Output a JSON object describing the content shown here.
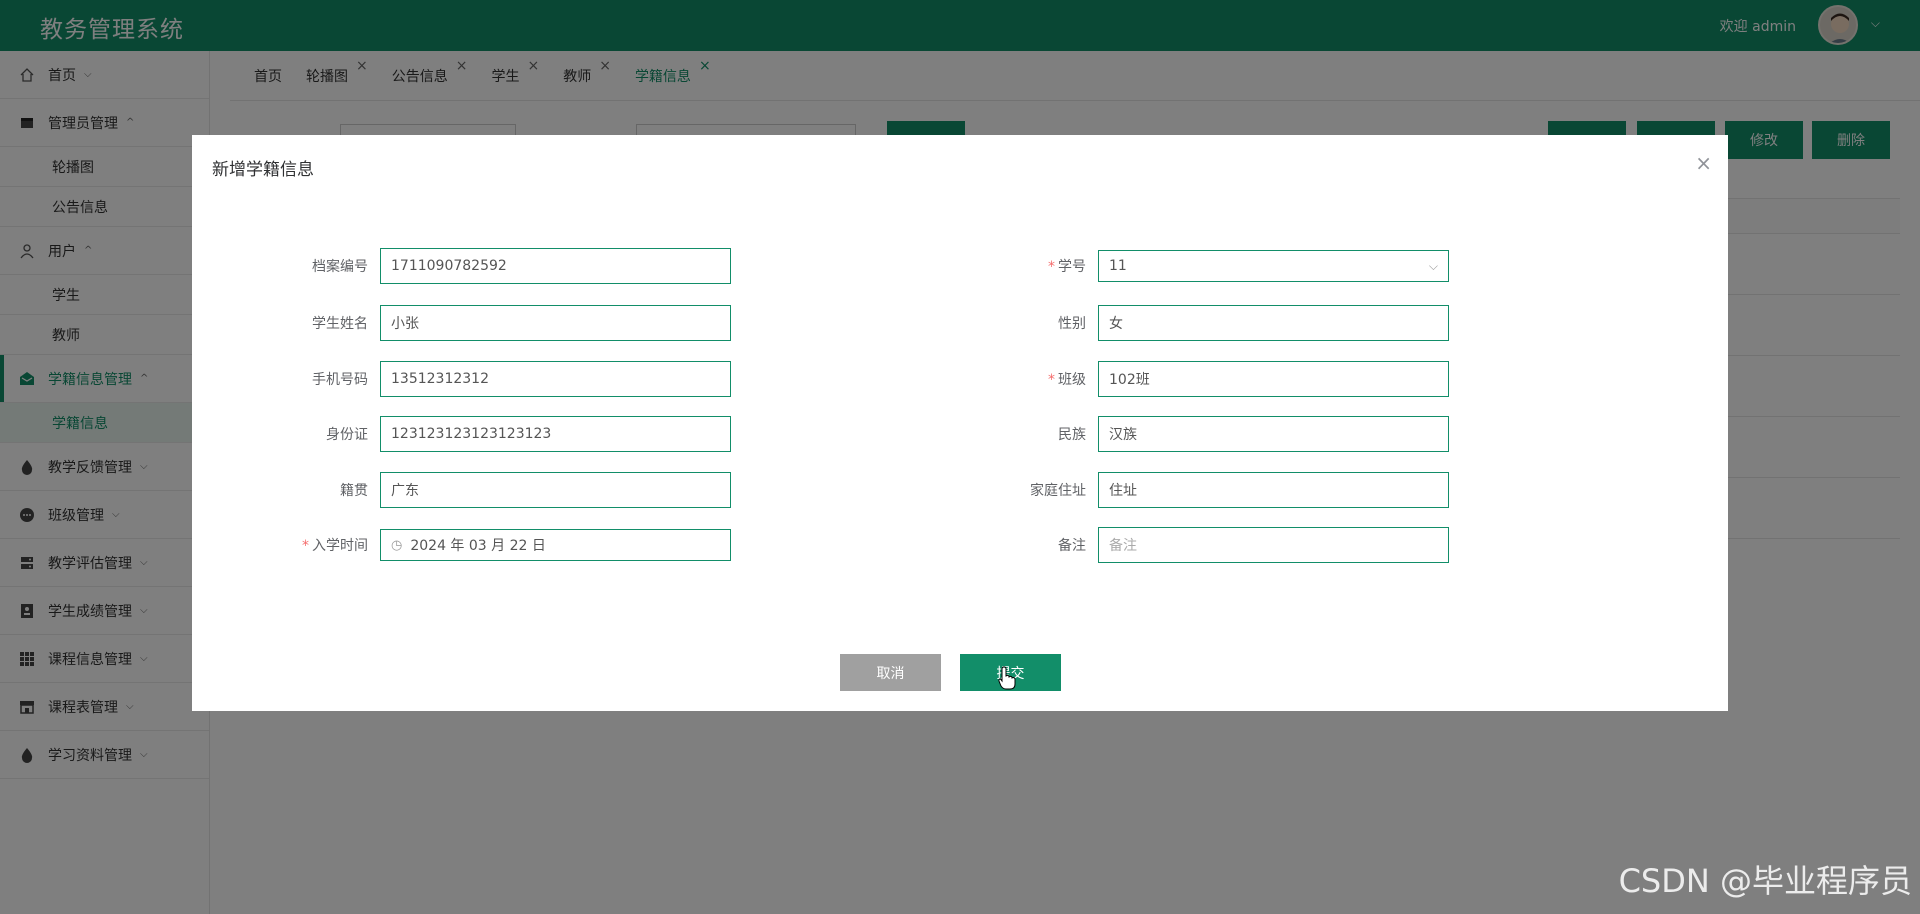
{
  "header": {
    "app_title": "教务管理系统",
    "welcome": "欢迎 admin",
    "caret": "⌵"
  },
  "sidebar": {
    "items": [
      {
        "label": "首页",
        "caret": "⌵"
      },
      {
        "label": "管理员管理",
        "caret": "^"
      },
      {
        "label": "轮播图"
      },
      {
        "label": "公告信息"
      },
      {
        "label": "用户",
        "caret": "^"
      },
      {
        "label": "学生"
      },
      {
        "label": "教师"
      },
      {
        "label": "学籍信息管理",
        "caret": "^"
      },
      {
        "label": "学籍信息"
      },
      {
        "label": "教学反馈管理",
        "caret": "⌵"
      },
      {
        "label": "班级管理",
        "caret": "⌵"
      },
      {
        "label": "教学评估管理",
        "caret": "⌵"
      },
      {
        "label": "学生成绩管理",
        "caret": "⌵"
      },
      {
        "label": "课程信息管理",
        "caret": "⌵"
      },
      {
        "label": "课程表管理",
        "caret": "⌵"
      },
      {
        "label": "学习资料管理",
        "caret": "⌵"
      }
    ]
  },
  "tabs": [
    {
      "label": "首页",
      "close": ""
    },
    {
      "label": "轮播图",
      "close": "×"
    },
    {
      "label": "公告信息",
      "close": "×"
    },
    {
      "label": "学生",
      "close": "×"
    },
    {
      "label": "教师",
      "close": "×"
    },
    {
      "label": "学籍信息",
      "close": "×"
    }
  ],
  "toolbar": {
    "edit_label": "修改",
    "delete_label": "删除"
  },
  "dialog": {
    "title": "新增学籍信息",
    "close": "×",
    "left_fields": [
      {
        "label": "档案编号",
        "value": "1711090782592",
        "required": false
      },
      {
        "label": "学生姓名",
        "value": "小张",
        "required": false
      },
      {
        "label": "手机号码",
        "value": "13512312312",
        "required": false
      },
      {
        "label": "身份证",
        "value": "123123123123123123",
        "required": false
      },
      {
        "label": "籍贯",
        "value": "广东",
        "required": false
      },
      {
        "label": "入学时间",
        "value": "2024 年 03 月 22 日",
        "required": true
      }
    ],
    "right_fields": [
      {
        "label": "学号",
        "value": "11",
        "required": true
      },
      {
        "label": "性别",
        "value": "女",
        "required": false
      },
      {
        "label": "班级",
        "value": "102班",
        "required": true
      },
      {
        "label": "民族",
        "value": "汉族",
        "required": false
      },
      {
        "label": "家庭住址",
        "value": "住址",
        "required": false
      },
      {
        "label": "备注",
        "placeholder": "备注",
        "required": false
      }
    ],
    "required_mark": "*",
    "cancel_label": "取消",
    "submit_label": "提交"
  },
  "watermark": "CSDN @毕业程序员",
  "colors": {
    "primary": "#128e69",
    "required": "#f56c6c",
    "cancel": "#a0a0a0"
  }
}
